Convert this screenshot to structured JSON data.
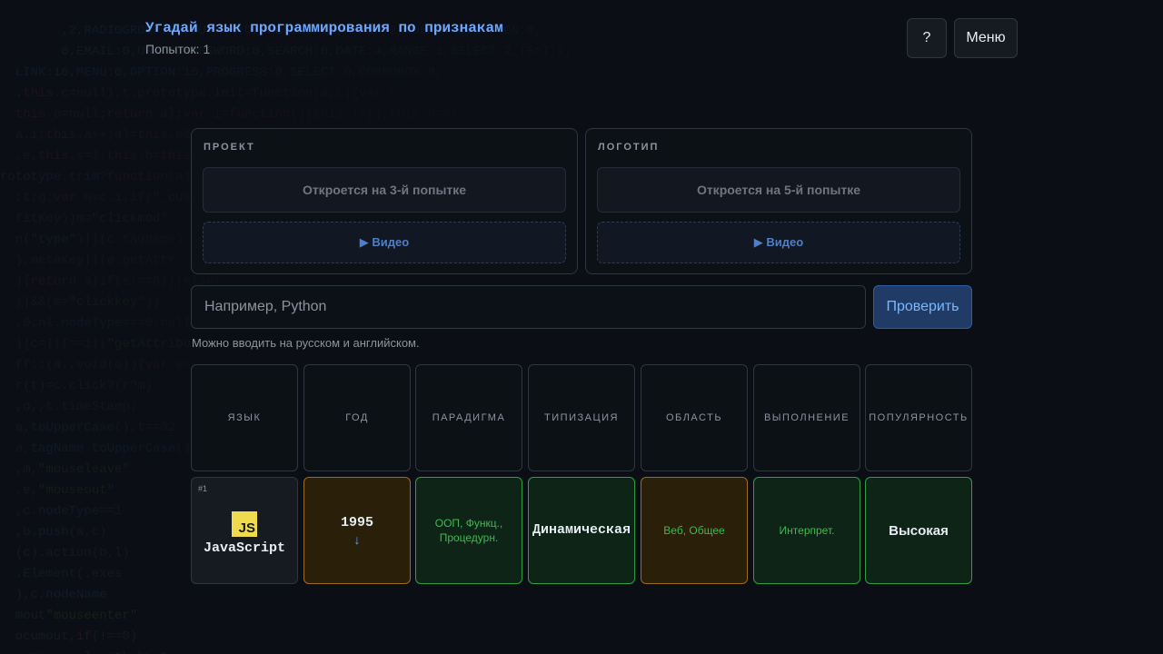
{
  "header": {
    "title": "Угадай язык программирования по признакам",
    "attempts": "Попыток: 1",
    "help_label": "?",
    "menu_label": "Меню"
  },
  "clues": {
    "project": {
      "label": "ПРОЕКТ",
      "locked_text": "Откроется на 3-й попытке",
      "video_label": "▶ Видео"
    },
    "logo": {
      "label": "ЛОГОТИП",
      "locked_text": "Откроется на 5-й попытке",
      "video_label": "▶ Видео"
    }
  },
  "guess": {
    "placeholder": "Например, Python",
    "value": "",
    "submit_label": "Проверить",
    "hint": "Можно вводить на русском и английском."
  },
  "table": {
    "headers": [
      "ЯЗЫК",
      "ГОД",
      "ПАРАДИГМА",
      "ТИПИЗАЦИЯ",
      "ОБЛАСТЬ",
      "ВЫПОЛНЕНИЕ",
      "ПОПУЛЯРНОСТЬ"
    ],
    "rows": [
      {
        "index": "#1",
        "language": "JavaScript",
        "logo_text": "JS",
        "year": "1995",
        "year_hint_icon": "arrow-down-icon",
        "year_arrow": "↓",
        "paradigm": "ООП, Функц., Процедурн.",
        "typing": "Динамическая",
        "domain": "Веб, Общее",
        "execution": "Интерпрет.",
        "popularity": "Высокая"
      }
    ]
  },
  "colors": {
    "accent": "#6ea8fe",
    "correct": "#2ea043",
    "partial": "#9a6b22",
    "background": "#0b0e14"
  }
}
